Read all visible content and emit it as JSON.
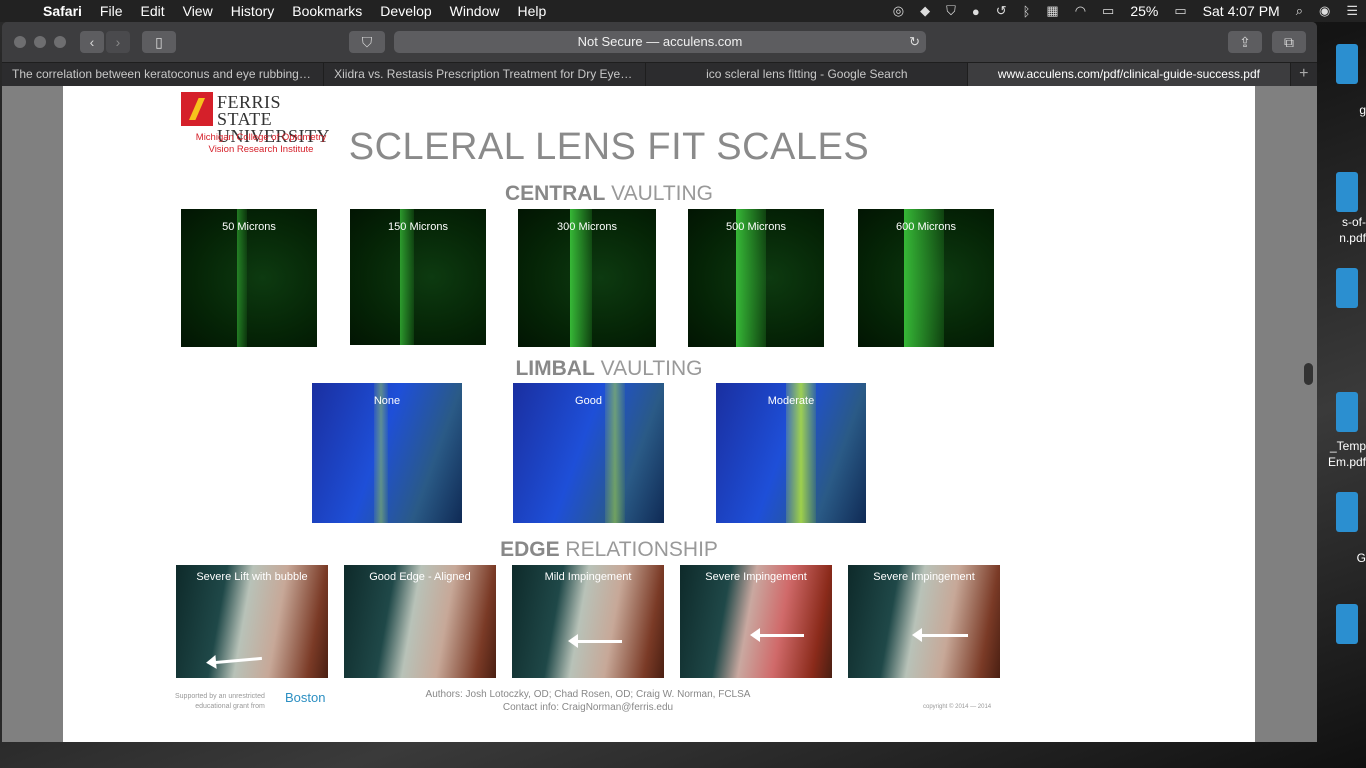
{
  "menubar": {
    "app": "Safari",
    "items": [
      "File",
      "Edit",
      "View",
      "History",
      "Bookmarks",
      "Develop",
      "Window",
      "Help"
    ],
    "battery": "25%",
    "clock": "Sat 4:07 PM"
  },
  "toolbar": {
    "address": "Not Secure — acculens.com"
  },
  "tabs": [
    {
      "title": "The correlation between keratoconus and eye rubbing: a..."
    },
    {
      "title": "Xiidra vs. Restasis Prescription Treatment for Dry Eyes:..."
    },
    {
      "title": "ico scleral lens fitting - Google Search"
    },
    {
      "title": "www.acculens.com/pdf/clinical-guide-success.pdf"
    }
  ],
  "desktop_files": [
    {
      "label": "g"
    },
    {
      "label": "s-of-\nn.pdf"
    },
    {
      "label": "_Temp\nEm.pdf"
    },
    {
      "label": "G"
    }
  ],
  "pdf": {
    "logo": {
      "name_line1": "FERRIS STATE",
      "name_line2": "UNIVERSITY",
      "sub_line1": "Michigan College of Optometry",
      "sub_line2": "Vision Research Institute"
    },
    "title": "SCLERAL LENS FIT SCALES",
    "central": {
      "bold": "CENTRAL",
      "rest": " VAULTING",
      "images": [
        "50 Microns",
        "150 Microns",
        "300 Microns",
        "500 Microns",
        "600 Microns"
      ]
    },
    "limbal": {
      "bold": "LIMBAL",
      "rest": " VAULTING",
      "images": [
        "None",
        "Good",
        "Moderate"
      ]
    },
    "edge": {
      "bold": "EDGE",
      "rest": " RELATIONSHIP",
      "images": [
        "Severe Lift with bubble",
        "Good Edge - Aligned",
        "Mild Impingement",
        "Severe Impingement",
        "Severe Impingement"
      ]
    },
    "footer": {
      "support_line1": "Supported by an unrestricted",
      "support_line2": "educational grant from",
      "brand": "Boston",
      "authors": "Authors: Josh Lotoczky, OD; Chad Rosen, OD; Craig W. Norman, FCLSA",
      "contact": "Contact info:  CraigNorman@ferris.edu",
      "copyright": "copyright © 2014 — 2014"
    }
  }
}
